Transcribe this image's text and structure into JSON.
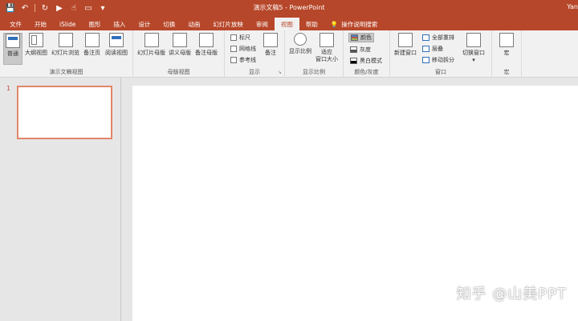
{
  "titlebar": {
    "title": "演示文稿5 - PowerPoint",
    "user": "Yan",
    "qat": [
      {
        "icon": "save-icon",
        "glyph": "💾"
      },
      {
        "icon": "undo-icon",
        "glyph": "↶"
      },
      {
        "icon": "redo-icon",
        "glyph": "↻"
      },
      {
        "icon": "start-from-beginning-icon",
        "glyph": "▶"
      },
      {
        "icon": "touch-mode-icon",
        "glyph": "☝"
      },
      {
        "icon": "new-slide-icon",
        "glyph": "▭"
      },
      {
        "icon": "customize-qat-icon",
        "glyph": "▾"
      }
    ],
    "accent": "#b7472a"
  },
  "tabs": {
    "items": [
      "文件",
      "开始",
      "iSlide",
      "图形",
      "插入",
      "设计",
      "切换",
      "动画",
      "幻灯片放映",
      "审阅",
      "视图",
      "帮助"
    ],
    "active": "视图",
    "search_label": "操作说明搜索"
  },
  "ribbon": {
    "presentation_views": {
      "label": "演示文稿视图",
      "buttons": [
        "普通",
        "大纲视图",
        "幻灯片浏览",
        "备注页",
        "阅读视图"
      ]
    },
    "master_views": {
      "label": "母版视图",
      "buttons": [
        "幻灯片母版",
        "讲义母版",
        "备注母版"
      ]
    },
    "show": {
      "label": "显示",
      "checks": [
        "标尺",
        "网格线",
        "参考线"
      ],
      "notes": "备注"
    },
    "zoom": {
      "label": "显示比例",
      "zoom": "显示比例",
      "fit_line1": "适应",
      "fit_line2": "窗口大小"
    },
    "color": {
      "label": "颜色/灰度",
      "options": [
        "颜色",
        "灰度",
        "黑白模式"
      ],
      "selected": "颜色"
    },
    "window": {
      "label": "窗口",
      "new_window": "新建窗口",
      "arrange_all": "全部重排",
      "cascade": "层叠",
      "move_split": "移动拆分",
      "switch": "切换窗口"
    },
    "macros": {
      "label": "宏",
      "button": "宏"
    }
  },
  "slides": {
    "thumbnails": [
      {
        "number": "1"
      }
    ]
  },
  "watermark": "知乎 @山美PPT"
}
